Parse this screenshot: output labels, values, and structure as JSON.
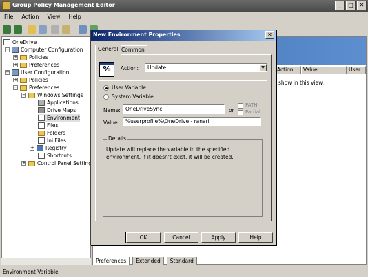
{
  "window": {
    "title": "Group Policy Management Editor"
  },
  "menu": [
    "File",
    "Action",
    "View",
    "Help"
  ],
  "tree": {
    "root": "OneDrive",
    "items": [
      {
        "label": "Computer Configuration"
      },
      {
        "label": "Policies"
      },
      {
        "label": "Preferences"
      },
      {
        "label": "User Configuration"
      },
      {
        "label": "Policies"
      },
      {
        "label": "Preferences"
      },
      {
        "label": "Windows Settings"
      },
      {
        "label": "Applications"
      },
      {
        "label": "Drive Maps"
      },
      {
        "label": "Environment"
      },
      {
        "label": "Files"
      },
      {
        "label": "Folders"
      },
      {
        "label": "Ini Files"
      },
      {
        "label": "Registry"
      },
      {
        "label": "Shortcuts"
      },
      {
        "label": "Control Panel Settings"
      }
    ]
  },
  "list": {
    "columns": [
      "Action",
      "Value",
      "User"
    ],
    "empty_message": "o show in this view."
  },
  "bottom_tabs": [
    "Preferences",
    "Extended",
    "Standard"
  ],
  "status": "Environment Variable",
  "dialog": {
    "title": "New Environment Properties",
    "tabs": [
      "General",
      "Common"
    ],
    "action_label": "Action:",
    "action_value": "Update",
    "radio_user": "User Variable",
    "radio_system": "System Variable",
    "name_label": "Name:",
    "name_value": "OneDriveSync",
    "or_label": "or",
    "path_label": "PATH",
    "partial_label": "Partial",
    "value_label": "Value:",
    "value_value": "%userprofile%\\OneDrive - ranari",
    "details_label": "Details",
    "details_text": "Update will replace the variable in the specified environment. If it doesn't exist, it will be created.",
    "buttons": {
      "ok": "OK",
      "cancel": "Cancel",
      "apply": "Apply",
      "help": "Help"
    }
  }
}
